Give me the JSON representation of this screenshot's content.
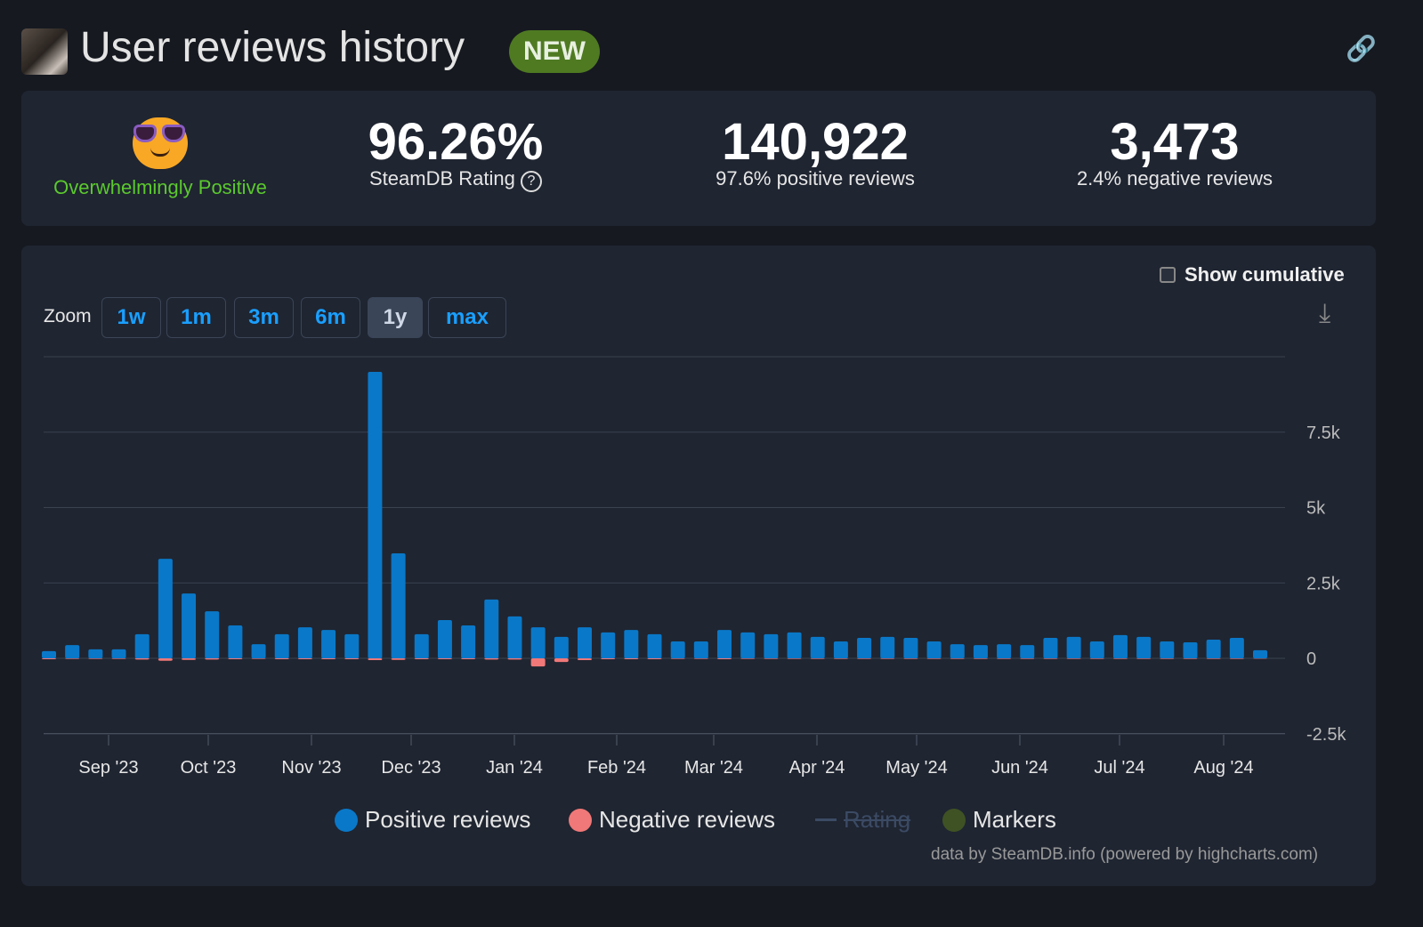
{
  "header": {
    "title": "User reviews history",
    "badge": "NEW"
  },
  "stats": {
    "rating_label": "Overwhelmingly Positive",
    "steamdb_rating": "96.26%",
    "steamdb_rating_label": "SteamDB Rating",
    "help": "?",
    "positive_count": "140,922",
    "positive_label": "97.6% positive reviews",
    "negative_count": "3,473",
    "negative_label": "2.4% negative reviews"
  },
  "controls": {
    "show_cumulative": "Show cumulative",
    "zoom_label": "Zoom",
    "zoom_options": [
      "1w",
      "1m",
      "3m",
      "6m",
      "1y",
      "max"
    ],
    "zoom_selected": "1y"
  },
  "colors": {
    "positive": "#0a78c8",
    "negative": "#f07878",
    "rating": "#3b4a64",
    "markers": "#3f5224",
    "accent": "#1a9fff",
    "rating_green": "#5bc92e"
  },
  "chart_data": {
    "type": "bar",
    "title": "User reviews history",
    "xlabel": "",
    "ylabel": "",
    "ylim": [
      -2500,
      10000
    ],
    "yticks": [
      {
        "v": 7500,
        "label": "7.5k"
      },
      {
        "v": 5000,
        "label": "5k"
      },
      {
        "v": 2500,
        "label": "2.5k"
      },
      {
        "v": 0,
        "label": "0"
      },
      {
        "v": -2500,
        "label": "-2.5k"
      }
    ],
    "xticks": [
      "Sep '23",
      "Oct '23",
      "Nov '23",
      "Dec '23",
      "Jan '24",
      "Feb '24",
      "Mar '24",
      "Apr '24",
      "May '24",
      "Jun '24",
      "Jul '24",
      "Aug '24"
    ],
    "grid": true,
    "legend": {
      "position": "bottom",
      "items": [
        "Positive reviews",
        "Negative reviews",
        "Rating",
        "Markers"
      ]
    },
    "series": [
      {
        "name": "Positive reviews",
        "values": [
          240,
          440,
          300,
          300,
          800,
          3300,
          2150,
          1560,
          1090,
          470,
          800,
          1030,
          940,
          800,
          9500,
          3480,
          800,
          1270,
          1090,
          1950,
          1390,
          1030,
          710,
          1030,
          860,
          940,
          800,
          560,
          560,
          940,
          860,
          800,
          860,
          710,
          560,
          680,
          710,
          680,
          560,
          470,
          440,
          470,
          440,
          680,
          710,
          560,
          770,
          710,
          560,
          530,
          620,
          680,
          270
        ]
      },
      {
        "name": "Negative reviews",
        "values": [
          -30,
          -20,
          -20,
          -20,
          -40,
          -80,
          -50,
          -40,
          -30,
          -20,
          -30,
          -30,
          -30,
          -30,
          -60,
          -50,
          -30,
          -30,
          -30,
          -40,
          -40,
          -270,
          -120,
          -60,
          -30,
          -30,
          -30,
          -20,
          -20,
          -30,
          -20,
          -20,
          -20,
          -20,
          -20,
          -20,
          -20,
          -20,
          -20,
          -20,
          -20,
          -20,
          -20,
          -20,
          -20,
          -20,
          -20,
          -20,
          -20,
          -20,
          -20,
          -20,
          -10
        ]
      }
    ]
  },
  "credit": "data by SteamDB.info (powered by highcharts.com)"
}
